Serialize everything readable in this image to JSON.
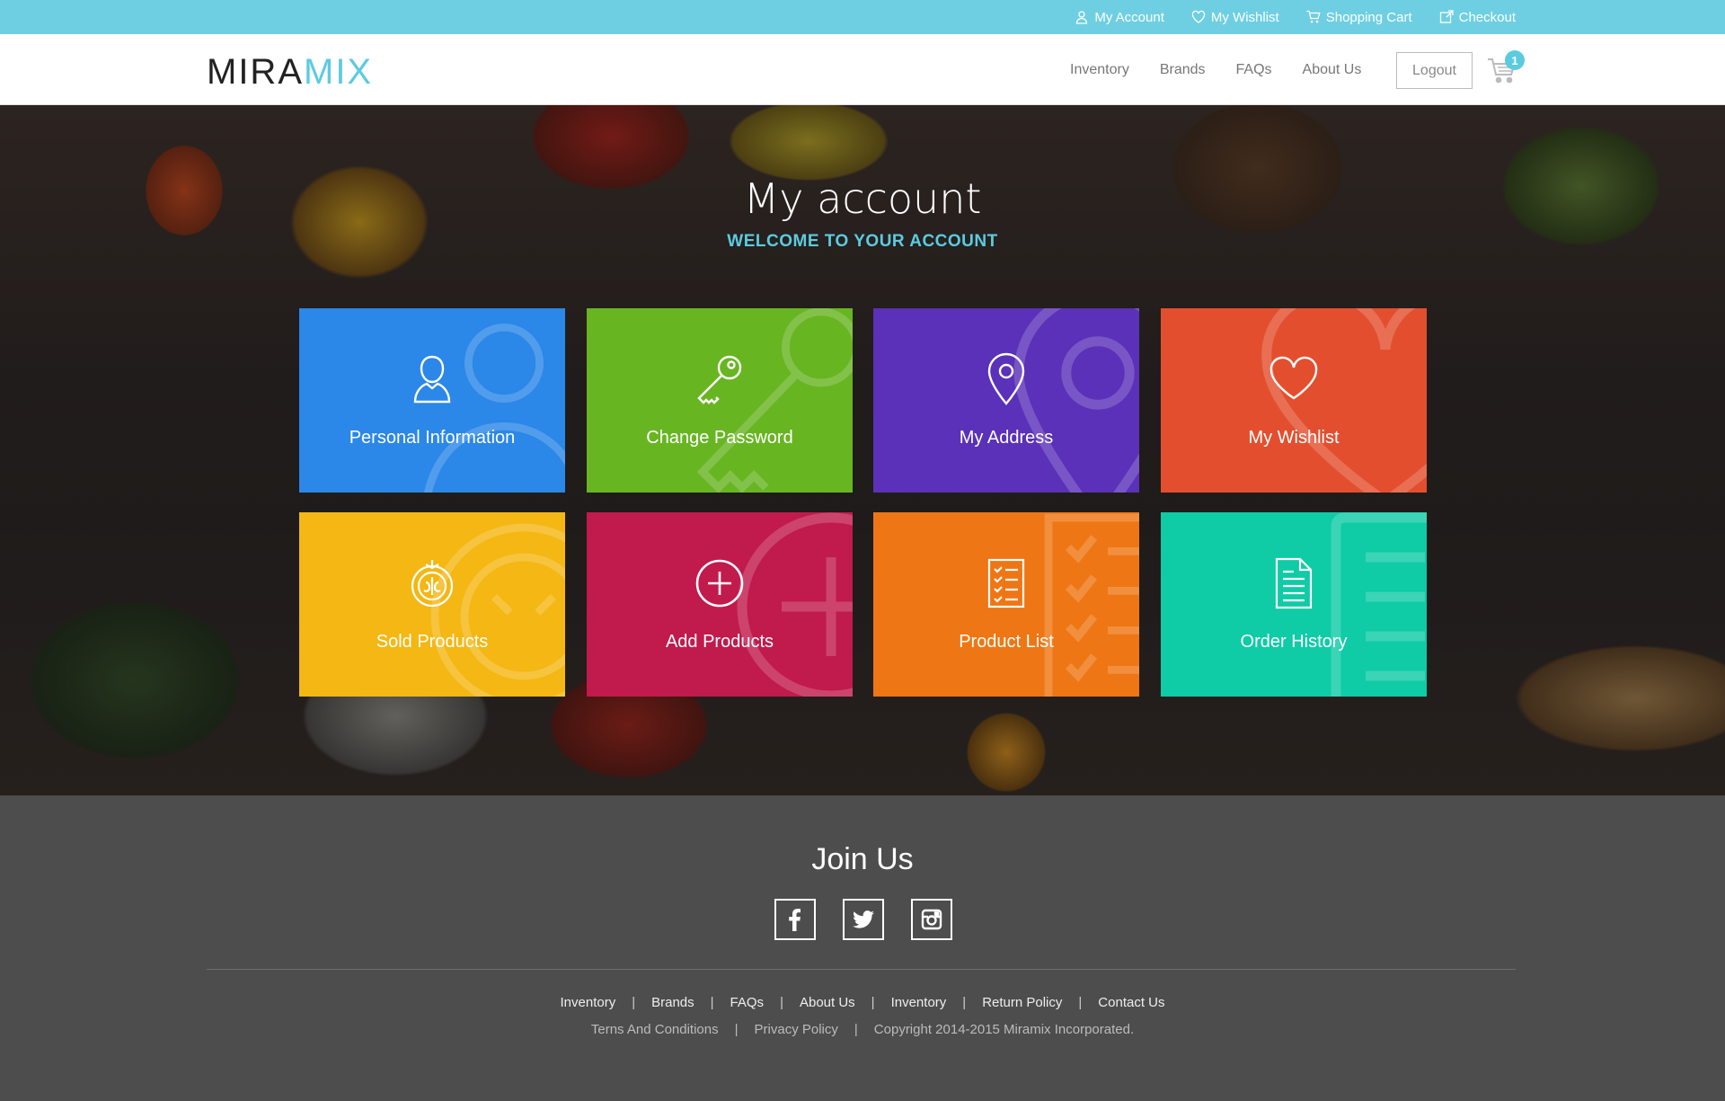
{
  "topbar": {
    "links": [
      {
        "label": "My Account",
        "icon": "user-icon"
      },
      {
        "label": "My Wishlist",
        "icon": "heart-icon"
      },
      {
        "label": "Shopping Cart",
        "icon": "cart-icon"
      },
      {
        "label": "Checkout",
        "icon": "checkout-icon"
      }
    ]
  },
  "header": {
    "logo_part1": "MIRA",
    "logo_part2": "MIX",
    "nav": [
      "Inventory",
      "Brands",
      "FAQs",
      "About Us"
    ],
    "logout_label": "Logout",
    "cart_count": "1"
  },
  "hero": {
    "title": "My account",
    "subtitle": "WELCOME TO YOUR ACCOUNT"
  },
  "tiles": [
    {
      "label": "Personal Information",
      "color": "#2b87e8",
      "icon": "user-icon"
    },
    {
      "label": "Change Password",
      "color": "#68b522",
      "icon": "key-icon"
    },
    {
      "label": "My Address",
      "color": "#5a31b8",
      "icon": "map-pin-icon"
    },
    {
      "label": "My Wishlist",
      "color": "#e34f2e",
      "icon": "heart-icon"
    },
    {
      "label": "Sold Products",
      "color": "#f4b713",
      "icon": "tomato-icon"
    },
    {
      "label": "Add Products",
      "color": "#c11a4c",
      "icon": "plus-circle-icon"
    },
    {
      "label": "Product List",
      "color": "#ef7614",
      "icon": "checklist-icon"
    },
    {
      "label": "Order History",
      "color": "#0fcba6",
      "icon": "document-icon"
    }
  ],
  "footer": {
    "join_title": "Join Us",
    "social": [
      "facebook-icon",
      "twitter-icon",
      "instagram-icon"
    ],
    "links": [
      "Inventory",
      "Brands",
      "FAQs",
      "About Us",
      "Inventory",
      "Return Policy",
      "Contact Us"
    ],
    "terms": "Terns And Conditions",
    "privacy": "Privacy Policy",
    "copyright": "Copyright 2014-2015 Miramix Incorporated."
  },
  "colors": {
    "accent": "#5ccbe0",
    "topbar": "#6fcfe2",
    "footer": "#4d4d4d"
  }
}
